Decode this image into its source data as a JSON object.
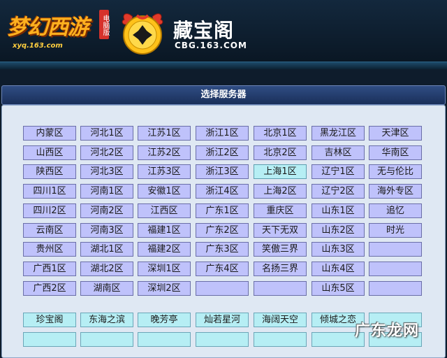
{
  "header": {
    "game_logo_text": "梦幻西游",
    "game_logo_badge": "电脑版",
    "game_logo_url": "xyq.163.com",
    "cbg_title": "藏宝阁",
    "cbg_url": "CBG.163.COM"
  },
  "page_title": "选择服务器",
  "servers": [
    [
      "内蒙区",
      "河北1区",
      "江苏1区",
      "浙江1区",
      "北京1区",
      "黑龙江区",
      "天津区"
    ],
    [
      "山西区",
      "河北2区",
      "江苏2区",
      "浙江2区",
      "北京2区",
      "吉林区",
      "华南区"
    ],
    [
      "陕西区",
      "河北3区",
      "江苏3区",
      "浙江3区",
      "上海1区",
      "辽宁1区",
      "无与伦比"
    ],
    [
      "四川1区",
      "河南1区",
      "安徽1区",
      "浙江4区",
      "上海2区",
      "辽宁2区",
      "海外专区"
    ],
    [
      "四川2区",
      "河南2区",
      "江西区",
      "广东1区",
      "重庆区",
      "山东1区",
      "追忆"
    ],
    [
      "云南区",
      "河南3区",
      "福建1区",
      "广东2区",
      "天下无双",
      "山东2区",
      "时光"
    ],
    [
      "贵州区",
      "湖北1区",
      "福建2区",
      "广东3区",
      "笑傲三界",
      "山东3区",
      ""
    ],
    [
      "广西1区",
      "湖北2区",
      "深圳1区",
      "广东4区",
      "名扬三界",
      "山东4区",
      ""
    ],
    [
      "广西2区",
      "湖南区",
      "深圳2区",
      "",
      "",
      "山东5区",
      ""
    ]
  ],
  "highlighted_server": "上海1区",
  "special_servers": [
    [
      "珍宝阁",
      "东海之滨",
      "晚芳亭",
      "灿若星河",
      "海阔天空",
      "倾城之恋",
      ""
    ],
    [
      "",
      "",
      "",
      "",
      "",
      "",
      ""
    ]
  ],
  "watermark": "广东龙网"
}
